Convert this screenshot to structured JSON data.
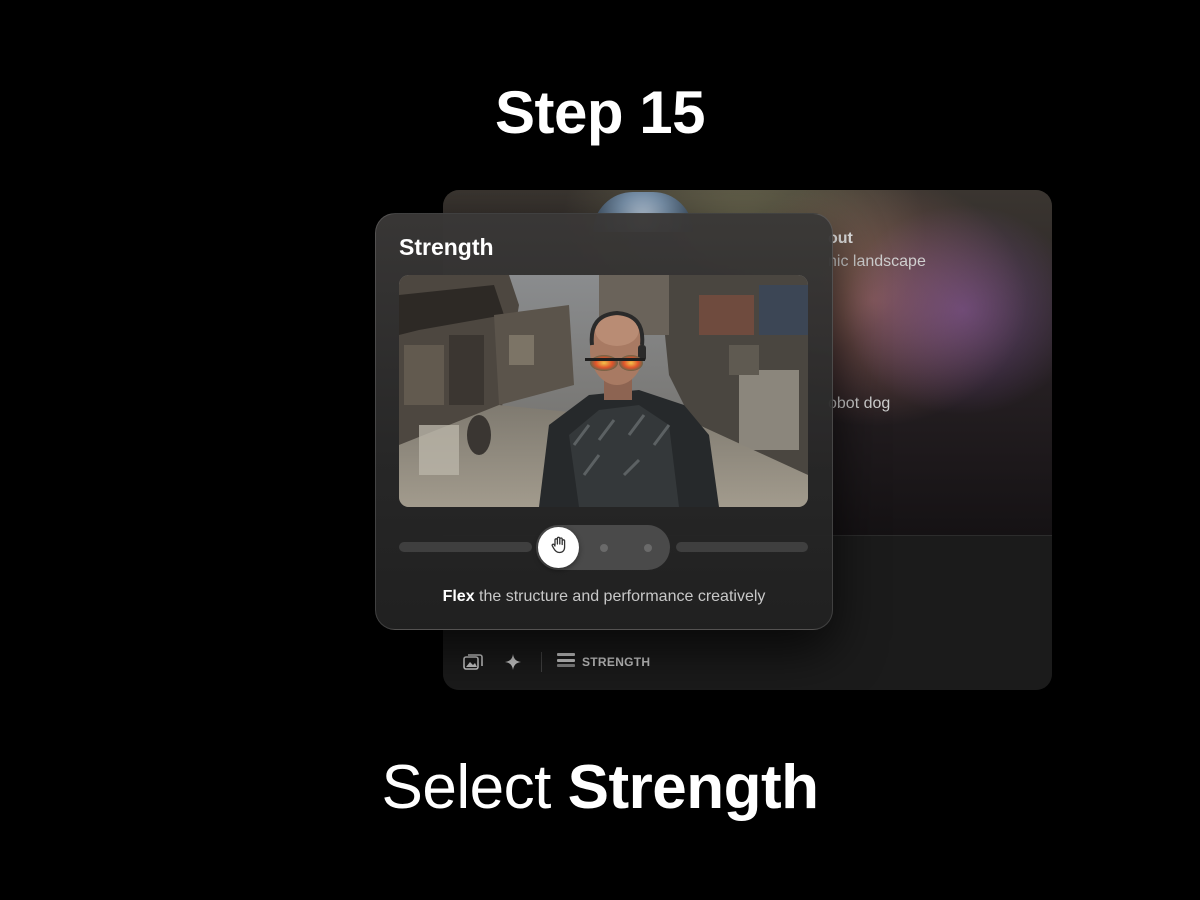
{
  "heading": {
    "step": "Step 15"
  },
  "caption": {
    "prefix": "Select",
    "bold": "Strength"
  },
  "back_panel": {
    "line_1": "out",
    "line_2": "nic landscape",
    "line_3": "obot dog",
    "toolbar": {
      "icons": [
        "image-stack-icon",
        "sparkle-icon",
        "strength-icon"
      ],
      "label": "STRENGTH"
    }
  },
  "strength_card": {
    "title": "Strength",
    "slider": {
      "selected_index": 0,
      "steps": 3,
      "selected_icon": "hand-icon"
    },
    "description_bold": "Flex",
    "description_rest": " the structure and performance creatively"
  },
  "colors": {
    "background": "#000000",
    "card": "#2e2d2c",
    "knob": "#ffffff",
    "track": "#3f3f3f"
  }
}
